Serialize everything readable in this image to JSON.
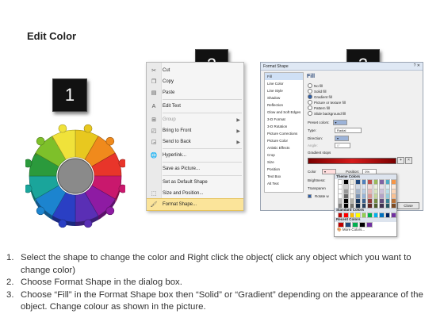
{
  "title": "Edit Color",
  "badges": [
    "1",
    "2",
    "3"
  ],
  "context_menu": {
    "items": [
      {
        "label": "Cut",
        "icon": "scissors-icon",
        "disabled": false
      },
      {
        "label": "Copy",
        "icon": "copy-icon",
        "disabled": false
      },
      {
        "label": "Paste",
        "icon": "paste-icon",
        "disabled": false
      },
      {
        "label": "Edit Text",
        "icon": "edit-text-icon",
        "disabled": false
      },
      {
        "label": "Group",
        "icon": "group-icon",
        "disabled": true,
        "submenu": true
      },
      {
        "label": "Bring to Front",
        "icon": "bring-front-icon",
        "disabled": false,
        "submenu": true
      },
      {
        "label": "Send to Back",
        "icon": "send-back-icon",
        "disabled": false,
        "submenu": true
      },
      {
        "label": "Hyperlink...",
        "icon": "hyperlink-icon",
        "disabled": false
      },
      {
        "label": "Save as Picture...",
        "icon": "",
        "disabled": false
      },
      {
        "label": "Set as Default Shape",
        "icon": "",
        "disabled": false
      },
      {
        "label": "Size and Position...",
        "icon": "size-position-icon",
        "disabled": false
      },
      {
        "label": "Format Shape...",
        "icon": "format-shape-icon",
        "disabled": false,
        "highlighted": true
      }
    ]
  },
  "format_dialog": {
    "title": "Format Shape",
    "help": "?",
    "close": "✕",
    "categories": [
      "Fill",
      "Line Color",
      "Line Style",
      "Shadow",
      "Reflection",
      "Glow and Soft Edges",
      "3-D Format",
      "3-D Rotation",
      "Picture Corrections",
      "Picture Color",
      "Artistic Effects",
      "Crop",
      "Size",
      "Position",
      "Text Box",
      "Alt Text"
    ],
    "selected_category": "Fill",
    "fill_heading": "Fill",
    "fill_options": [
      "No fill",
      "Solid fill",
      "Gradient fill",
      "Picture or texture fill",
      "Pattern fill",
      "Slide background fill"
    ],
    "selected_fill": "Gradient fill",
    "preset_colors_label": "Preset colors:",
    "type_label": "Type:",
    "type_value": "Radial",
    "direction_label": "Direction:",
    "angle_label": "Angle:",
    "angle_value": "0°",
    "gradient_stops_label": "Gradient stops",
    "color_label": "Color",
    "position_label": "Position:",
    "position_value": "0%",
    "brightness_label": "Brightness:",
    "transparency_label": "Transparen",
    "rotate_label": "Rotate w",
    "close_button": "Close",
    "gradient_color": "#d61b1b"
  },
  "color_popup": {
    "theme_heading": "Theme Colors",
    "standard_heading": "Standard Colors",
    "recent_heading": "Recent Colors",
    "more_colors": "More Colors...",
    "theme_colors": [
      "#ffffff",
      "#000000",
      "#eeece1",
      "#1f497d",
      "#4f81bd",
      "#c0504d",
      "#9bbb59",
      "#8064a2",
      "#4bacc6",
      "#f79646"
    ],
    "standard_colors": [
      "#c00000",
      "#ff0000",
      "#ffc000",
      "#ffff00",
      "#92d050",
      "#00b050",
      "#00b0f0",
      "#0070c0",
      "#002060",
      "#7030a0"
    ],
    "recent_colors": [
      "#c00000",
      "#1f497d",
      "#00b050",
      "#000000",
      "#7030a0"
    ]
  },
  "wheel_colors": [
    "#e8c81f",
    "#f08a1c",
    "#e8352a",
    "#c9186d",
    "#8e1ba3",
    "#5a2fb5",
    "#2a3fc4",
    "#1c84cf",
    "#1aa59b",
    "#2b9a3c",
    "#7ec02a",
    "#f0e23a"
  ],
  "steps": [
    {
      "num": "1.",
      "text": "Select the shape to change the color and Right click the object( click any object which you want to change color)"
    },
    {
      "num": "2.",
      "text": "Choose Format Shape in the dialog box."
    },
    {
      "num": "3.",
      "text": "Choose “Fill” in the Format Shape box then “Solid” or “Gradient” depending on the appearance of the object. Change colour as shown in the picture."
    }
  ]
}
